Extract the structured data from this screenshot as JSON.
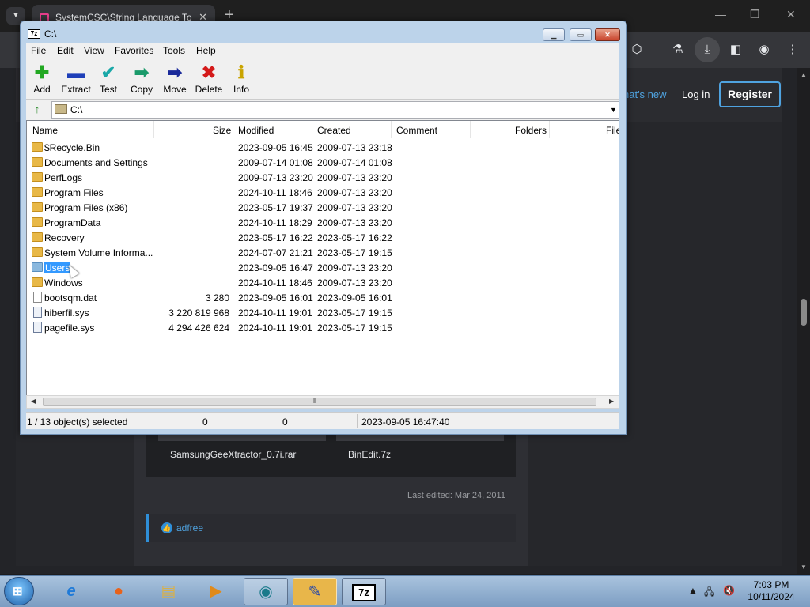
{
  "browser": {
    "tab_title": "SystemCSC\\String Language To",
    "tab_close": "✕",
    "new_tab": "+",
    "whats_new": "hat's new",
    "login": "Log in",
    "register": "Register",
    "attachments": [
      "SamsungGeeXtractor_0.7i.rar",
      "BinEdit.7z"
    ],
    "last_edited": "Last edited: Mar 24, 2011",
    "reaction_user": "adfree"
  },
  "zip": {
    "title": "C:\\",
    "menu": [
      "File",
      "Edit",
      "View",
      "Favorites",
      "Tools",
      "Help"
    ],
    "toolbar": [
      {
        "label": "Add",
        "icon": "plus-icon",
        "glyph": "✚",
        "color": "#22a822"
      },
      {
        "label": "Extract",
        "icon": "minus-icon",
        "glyph": "▬",
        "color": "#1e3fb8"
      },
      {
        "label": "Test",
        "icon": "check-icon",
        "glyph": "✔",
        "color": "#1aa8a8"
      },
      {
        "label": "Copy",
        "icon": "copy-arrow-icon",
        "glyph": "➡",
        "color": "#1a9a6a"
      },
      {
        "label": "Move",
        "icon": "move-arrow-icon",
        "glyph": "➡",
        "color": "#1a2a9a"
      },
      {
        "label": "Delete",
        "icon": "delete-icon",
        "glyph": "✖",
        "color": "#d41a1a"
      },
      {
        "label": "Info",
        "icon": "info-icon",
        "glyph": "ℹ",
        "color": "#c9a400"
      }
    ],
    "address": "C:\\",
    "columns": {
      "name": "Name",
      "size": "Size",
      "modified": "Modified",
      "created": "Created",
      "comment": "Comment",
      "folders": "Folders",
      "files": "File"
    },
    "rows": [
      {
        "name": "$Recycle.Bin",
        "size": "",
        "modified": "2023-09-05 16:45",
        "created": "2009-07-13 23:18",
        "type": "folder"
      },
      {
        "name": "Documents and Settings",
        "size": "",
        "modified": "2009-07-14 01:08",
        "created": "2009-07-14 01:08",
        "type": "folder"
      },
      {
        "name": "PerfLogs",
        "size": "",
        "modified": "2009-07-13 23:20",
        "created": "2009-07-13 23:20",
        "type": "folder"
      },
      {
        "name": "Program Files",
        "size": "",
        "modified": "2024-10-11 18:46",
        "created": "2009-07-13 23:20",
        "type": "folder"
      },
      {
        "name": "Program Files (x86)",
        "size": "",
        "modified": "2023-05-17 19:37",
        "created": "2009-07-13 23:20",
        "type": "folder"
      },
      {
        "name": "ProgramData",
        "size": "",
        "modified": "2024-10-11 18:29",
        "created": "2009-07-13 23:20",
        "type": "folder"
      },
      {
        "name": "Recovery",
        "size": "",
        "modified": "2023-05-17 16:22",
        "created": "2023-05-17 16:22",
        "type": "folder"
      },
      {
        "name": "System Volume Informa...",
        "size": "",
        "modified": "2024-07-07 21:21",
        "created": "2023-05-17 19:15",
        "type": "folder"
      },
      {
        "name": "Users",
        "size": "",
        "modified": "2023-09-05 16:47",
        "created": "2009-07-13 23:20",
        "type": "folder-open",
        "selected": true
      },
      {
        "name": "Windows",
        "size": "",
        "modified": "2024-10-11 18:46",
        "created": "2009-07-13 23:20",
        "type": "folder"
      },
      {
        "name": "bootsqm.dat",
        "size": "3 280",
        "modified": "2023-09-05 16:01",
        "created": "2023-09-05 16:01",
        "type": "file"
      },
      {
        "name": "hiberfil.sys",
        "size": "3 220 819 968",
        "modified": "2024-10-11 19:01",
        "created": "2023-05-17 19:15",
        "type": "sys"
      },
      {
        "name": "pagefile.sys",
        "size": "4 294 426 624",
        "modified": "2024-10-11 19:01",
        "created": "2023-05-17 19:15",
        "type": "sys"
      }
    ],
    "status": {
      "selection": "1 / 13 object(s) selected",
      "size": "0",
      "packed": "0",
      "modified": "2023-09-05 16:47:40"
    }
  },
  "taskbar": {
    "start_glyph": "⊞",
    "clock_time": "7:03 PM",
    "clock_date": "10/11/2024",
    "apps": [
      {
        "name": "internet-explorer-icon",
        "glyph": "e",
        "color": "#1e7ad8"
      },
      {
        "name": "firefox-icon",
        "glyph": "●",
        "color": "#e8621a"
      },
      {
        "name": "file-explorer-icon",
        "glyph": "▤",
        "color": "#d8b04a"
      },
      {
        "name": "media-player-icon",
        "glyph": "▶",
        "color": "#e08a1a"
      },
      {
        "name": "browser-app-icon",
        "glyph": "◉",
        "color": "#1a7a8a"
      },
      {
        "name": "archive-tool-icon",
        "glyph": "✎",
        "color": "#2a4aa8"
      },
      {
        "name": "7zip-taskbar-icon",
        "glyph": "7z",
        "color": "#000000"
      }
    ]
  }
}
